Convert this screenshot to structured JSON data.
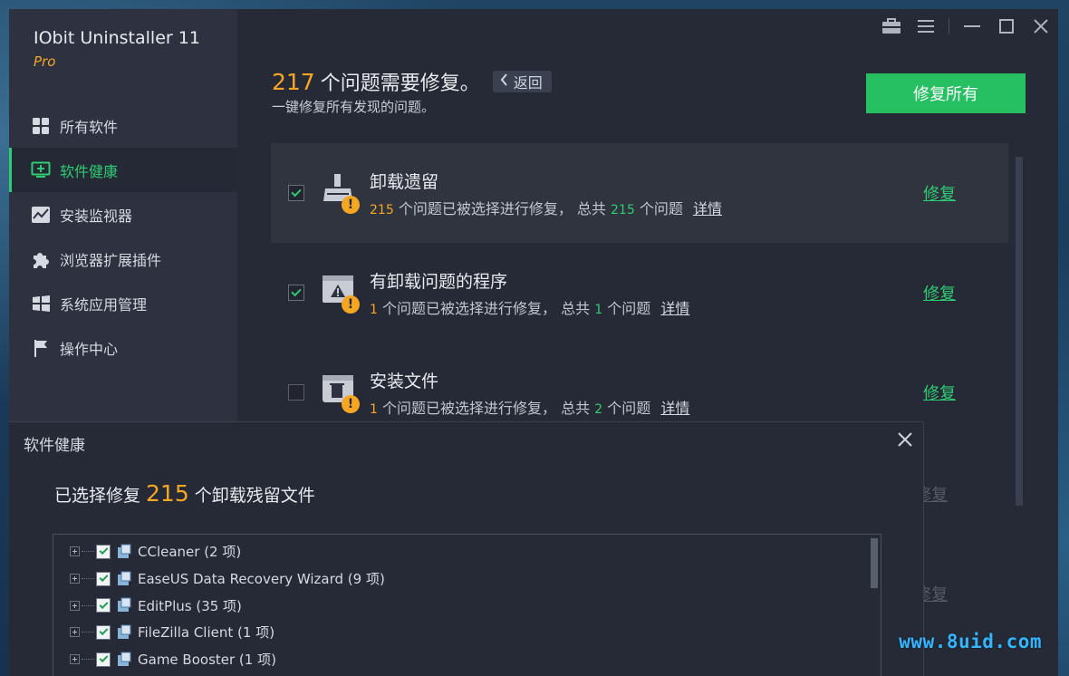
{
  "app": {
    "title": "IObit Uninstaller 11",
    "edition": "Pro"
  },
  "sidebar": {
    "items": [
      {
        "label": "所有软件",
        "icon": "grid-icon"
      },
      {
        "label": "软件健康",
        "icon": "health-monitor-icon",
        "active": true
      },
      {
        "label": "安装监视器",
        "icon": "chart-line-icon"
      },
      {
        "label": "浏览器扩展插件",
        "icon": "puzzle-icon"
      },
      {
        "label": "系统应用管理",
        "icon": "windows-logo-icon"
      },
      {
        "label": "操作中心",
        "icon": "flag-icon"
      }
    ]
  },
  "header": {
    "count": "217",
    "title": "个问题需要修复。",
    "back_label": "返回",
    "subtitle": "一键修复所有发现的问题。",
    "fix_all_label": "修复所有"
  },
  "issues": [
    {
      "title": "卸载遗留",
      "selected": "215",
      "desc1": "个问题已被选择进行修复， 总共",
      "total": "215",
      "desc2": "个问题",
      "detail": "详情",
      "fix": "修复",
      "checked": true,
      "icon": "broom-icon"
    },
    {
      "title": "有卸载问题的程序",
      "selected": "1",
      "desc1": "个问题已被选择进行修复， 总共",
      "total": "1",
      "desc2": "个问题",
      "detail": "详情",
      "fix": "修复",
      "checked": true,
      "icon": "window-warning-icon"
    },
    {
      "title": "安装文件",
      "selected": "1",
      "desc1": "个问题已被选择进行修复， 总共",
      "total": "2",
      "desc2": "个问题",
      "detail": "详情",
      "fix": "修复",
      "checked": false,
      "icon": "trash-box-icon"
    }
  ],
  "hidden_fix_links": [
    "修复",
    "修复"
  ],
  "dialog": {
    "title": "软件健康",
    "headline_prefix": "已选择修复",
    "count": "215",
    "headline_suffix": "个卸载残留文件",
    "items": [
      "CCleaner (2 项)",
      "EaseUS Data Recovery Wizard (9 项)",
      "EditPlus (35 项)",
      "FileZilla Client (1 项)",
      "Game Booster (1 项)"
    ]
  },
  "watermark": "www.8uid.com",
  "colors": {
    "accent_green": "#2ecc71",
    "accent_orange": "#f5a623",
    "button_green": "#26c063"
  }
}
